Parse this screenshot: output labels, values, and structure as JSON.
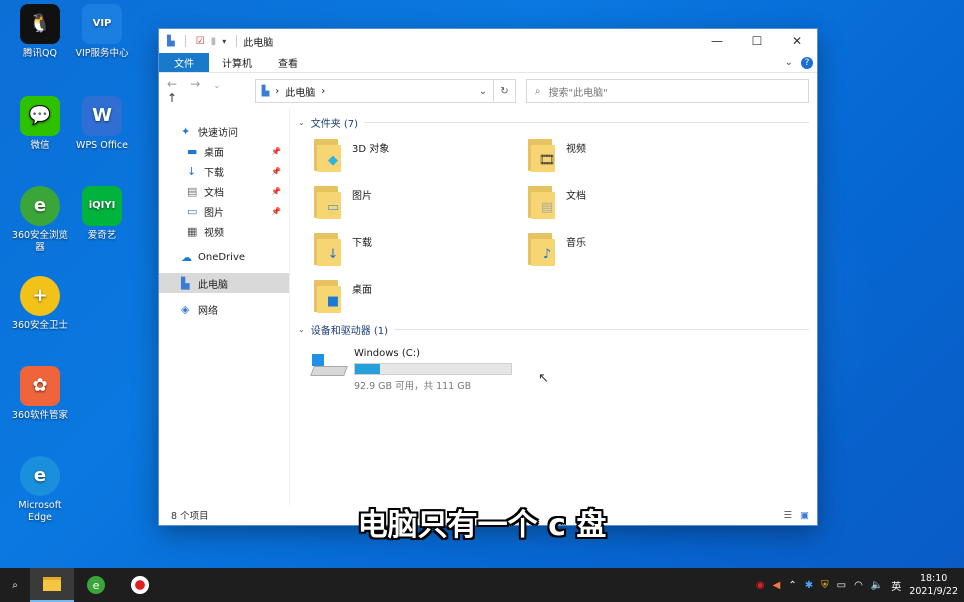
{
  "desktop_icons": [
    {
      "label": "腾讯QQ",
      "glyph": "🐧",
      "color": "#111111"
    },
    {
      "label": "VIP服务中心",
      "glyph": "VIP",
      "color": "#1a7fe0"
    },
    {
      "label": "微信",
      "glyph": "💬",
      "color": "#2dc100"
    },
    {
      "label": "WPS Office",
      "glyph": "W",
      "color": "#2f6fd3"
    },
    {
      "label": "360安全浏览器",
      "glyph": "e",
      "color": "#3aa63a"
    },
    {
      "label": "爱奇艺",
      "glyph": "iQIYI",
      "color": "#00b33c"
    },
    {
      "label": "360安全卫士",
      "glyph": "+",
      "color": "#f2c218"
    },
    {
      "label": "360软件管家",
      "glyph": "✿",
      "color": "#f0643c"
    },
    {
      "label": "Microsoft Edge",
      "glyph": "e",
      "color": "#1a8fdc"
    }
  ],
  "window": {
    "title": "此电脑",
    "controls": {
      "minimize": "—",
      "maximize": "☐",
      "close": "✕"
    },
    "ribbon_tabs": [
      "文件",
      "计算机",
      "查看"
    ],
    "help": "?",
    "address": {
      "crumb": "此电脑",
      "separator": "›"
    },
    "search_placeholder": "搜索\"此电脑\"",
    "nav_pane": {
      "quick_access": "快速访问",
      "quick_items": [
        "桌面",
        "下载",
        "文档",
        "图片",
        "视频"
      ],
      "onedrive": "OneDrive",
      "this_pc": "此电脑",
      "network": "网络"
    },
    "folders_header": "文件夹 (7)",
    "folders": [
      {
        "name": "3D 对象",
        "overlay": "◆"
      },
      {
        "name": "视频",
        "overlay": "🎞"
      },
      {
        "name": "图片",
        "overlay": "▭"
      },
      {
        "name": "文档",
        "overlay": "▤"
      },
      {
        "name": "下载",
        "overlay": "↓"
      },
      {
        "name": "音乐",
        "overlay": "♪"
      },
      {
        "name": "桌面",
        "overlay": "■"
      }
    ],
    "devices_header": "设备和驱动器 (1)",
    "drive": {
      "name": "Windows (C:)",
      "detail": "92.9 GB 可用，共 111 GB",
      "used_fraction": 0.163
    },
    "status": "8 个项目"
  },
  "subtitle": "电脑只有一个 c 盘",
  "taskbar": {
    "tray_lang": "英",
    "time": "18:10",
    "date": "2021/9/22"
  }
}
